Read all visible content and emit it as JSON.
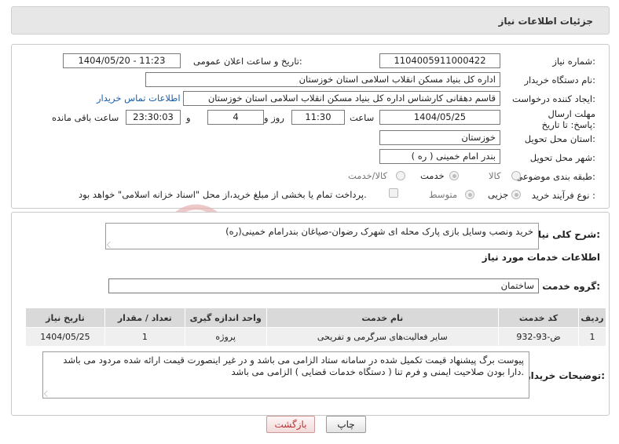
{
  "header": {
    "title": "جزئیات اطلاعات نیاز"
  },
  "labels": {
    "need_number": "شماره نیاز:",
    "announce_datetime": "تاریخ و ساعت اعلان عمومی:",
    "buyer_org": "نام دستگاه خریدار:",
    "requester": "ایجاد کننده درخواست:",
    "contact_link": "اطلاعات تماس خریدار",
    "deadline": "مهلت ارسال پاسخ: تا تاریخ:",
    "time_word": "ساعت",
    "day_word": "روز و",
    "remaining": "ساعت باقی مانده",
    "province": "استان محل تحویل:",
    "city": "شهر محل تحویل:",
    "category": "طبقه بندی موضوعی:",
    "process_type": "نوع فرآیند خرید :",
    "summary": "شرح کلی نیاز:",
    "services_info": "اطلاعات خدمات مورد نیاز",
    "service_group": "گروه خدمت:",
    "buyer_notes": "توضیحات خریدار:"
  },
  "values": {
    "need_number": "1104005911000422",
    "announce_datetime": "1404/05/20 - 11:23",
    "buyer_org": "اداره کل بنیاد مسکن انقلاب اسلامی استان خوزستان",
    "requester": "قاسم دهقانی کارشناس اداره کل بنیاد مسکن انقلاب اسلامی استان خوزستان",
    "deadline_date": "1404/05/25",
    "deadline_time": "11:30",
    "days_left": "4",
    "time_left": "23:30:03",
    "province": "خوزستان",
    "city": "بندر امام خمینی ( ره )",
    "summary": "خرید ونصب وسایل بازی پارک محله ای شهرک رضوان-صیاغان بندرامام خمینی(ره)",
    "service_group": "ساختمان",
    "buyer_notes_line1": "پیوست برگ پیشنهاد قیمت تکمیل شده در سامانه ستاد الزامی می باشد و در غیر اینصورت  قیمت ارائه شده مردود می باشد",
    "buyer_notes_line2": "دارا بودن صلاحیت ایمنی و فرم تنا ( دستگاه خدمات قضایی ) الزامی می باشد."
  },
  "category_options": [
    "کالا",
    "خدمت",
    "کالا/خدمت"
  ],
  "category_selected": "خدمت",
  "process_options": [
    "جزیی",
    "متوسط"
  ],
  "process_selected": "جزیی",
  "payment_note": "پرداخت تمام یا بخشی از مبلغ خرید،از محل \"اسناد خزانه اسلامی\" خواهد بود.",
  "table": {
    "headers": [
      "ردیف",
      "کد خدمت",
      "نام خدمت",
      "واحد اندازه گیری",
      "تعداد / مقدار",
      "تاریخ نیاز"
    ],
    "rows": [
      [
        "1",
        "ض-93-932",
        "سایر فعالیت‌های سرگرمی و تفریحی",
        "پروژه",
        "1",
        "1404/05/25"
      ]
    ]
  },
  "buttons": {
    "print": "چاپ",
    "back": "بازگشت"
  },
  "watermark": "AriaTender.neT",
  "colors": {
    "header_bg": "#e7e7e7",
    "table_header_bg": "#d9d9d9",
    "link": "#1a5ea8",
    "watermark": "#e8b4b4"
  }
}
